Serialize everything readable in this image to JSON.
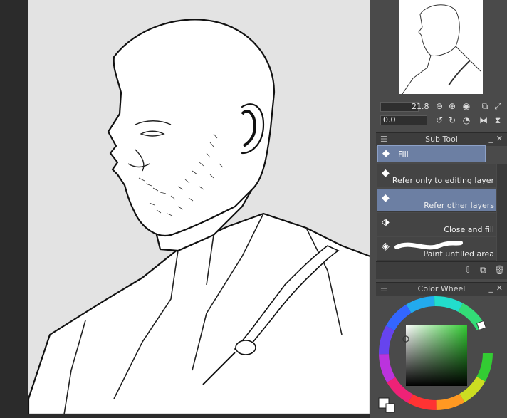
{
  "navigator": {
    "zoom_value": "21.8",
    "rotate_value": "0.0"
  },
  "subtool_panel": {
    "title": "Sub Tool",
    "active_group": "Fill",
    "items": [
      {
        "label": "Refer only to editing layer",
        "selected": false
      },
      {
        "label": "Refer other layers",
        "selected": true
      },
      {
        "label": "Close and fill",
        "selected": false
      },
      {
        "label": "Paint unfilled area",
        "selected": false
      }
    ]
  },
  "color_wheel_panel": {
    "title": "Color Wheel",
    "main_color": "#ffffff",
    "sub_color": "#ffffff"
  },
  "icons": [
    "zoom-out-icon",
    "zoom-in-icon",
    "fit-icon",
    "flip-icon",
    "rotate-left-icon",
    "rotate-right-icon",
    "reset-rotation-icon",
    "flip-horizontal-icon",
    "flip-vertical-icon",
    "fill-icon",
    "import-icon",
    "duplicate-icon",
    "trash-icon",
    "grip-icon",
    "minimize-icon",
    "close-icon"
  ],
  "colors": {
    "selection": "#6c7fa3",
    "panel_bg": "#4a4a4a",
    "canvas_bg": "#e3e3e3"
  }
}
